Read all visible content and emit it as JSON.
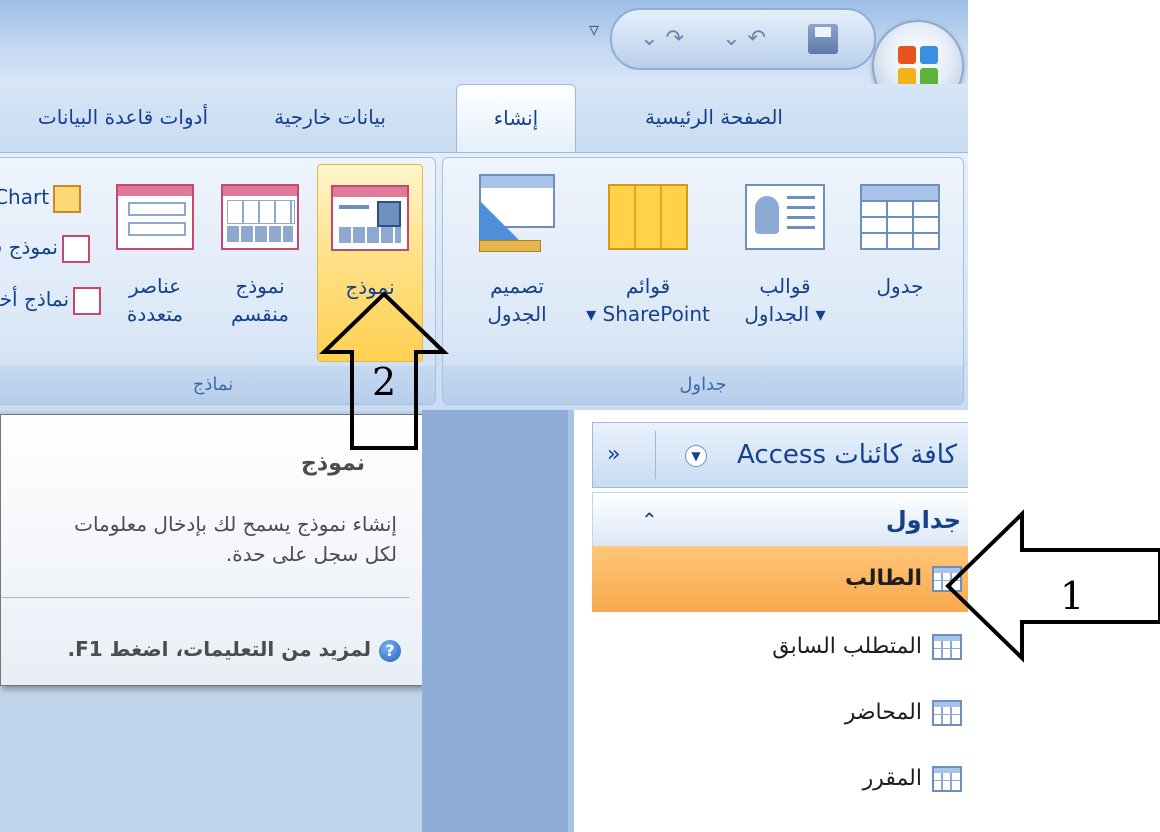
{
  "colors": {
    "accent": "#15428b",
    "selected_row": "#f7a84d",
    "hot_button": "#ffd052",
    "ribbon_bg": "#dce8f7"
  },
  "tabs": [
    {
      "label": "الصفحة الرئيسية",
      "active": false
    },
    {
      "label": "إنشاء",
      "active": true
    },
    {
      "label": "بيانات خارجية",
      "active": false
    },
    {
      "label": "أدوات قاعدة البيانات",
      "active": false
    }
  ],
  "ribbon": {
    "tables_group": {
      "label": "جداول",
      "buttons": [
        {
          "label1": "جدول",
          "label2": "",
          "icon": "table-icon"
        },
        {
          "label1": "قوالب",
          "label2": "الجداول ▾",
          "icon": "table-templates-icon"
        },
        {
          "label1": "قوائم",
          "label2": "▾ SharePoint",
          "icon": "sharepoint-lists-icon"
        },
        {
          "label1": "تصميم",
          "label2": "الجدول",
          "icon": "table-design-icon"
        }
      ]
    },
    "forms_group": {
      "label": "نماذج",
      "buttons": [
        {
          "label1": "نموذج",
          "label2": "",
          "icon": "form-icon"
        },
        {
          "label1": "نموذج",
          "label2": "منقسم",
          "icon": "split-form-icon"
        },
        {
          "label1": "عناصر",
          "label2": "متعددة",
          "icon": "multiple-items-icon"
        }
      ],
      "small_buttons": [
        "PivotChart",
        "نموذج فارغ",
        "نماذج أخرى"
      ]
    }
  },
  "tooltip": {
    "title": "نموذج",
    "line1": "إنشاء نموذج يسمح لك بإدخال معلومات",
    "line2": "لكل سجل على حدة.",
    "help": "لمزيد من التعليمات، اضغط F1."
  },
  "nav_pane": {
    "title": "كافة كائنات Access",
    "collapse_glyph": "»",
    "group": {
      "title": "جداول",
      "chevron": "⌃"
    },
    "items": [
      {
        "label": "الطالب",
        "selected": true
      },
      {
        "label": "المتطلب السابق",
        "selected": false
      },
      {
        "label": "المحاضر",
        "selected": false
      },
      {
        "label": "المقرر",
        "selected": false
      }
    ]
  },
  "callouts": {
    "one": "1",
    "two": "2"
  }
}
